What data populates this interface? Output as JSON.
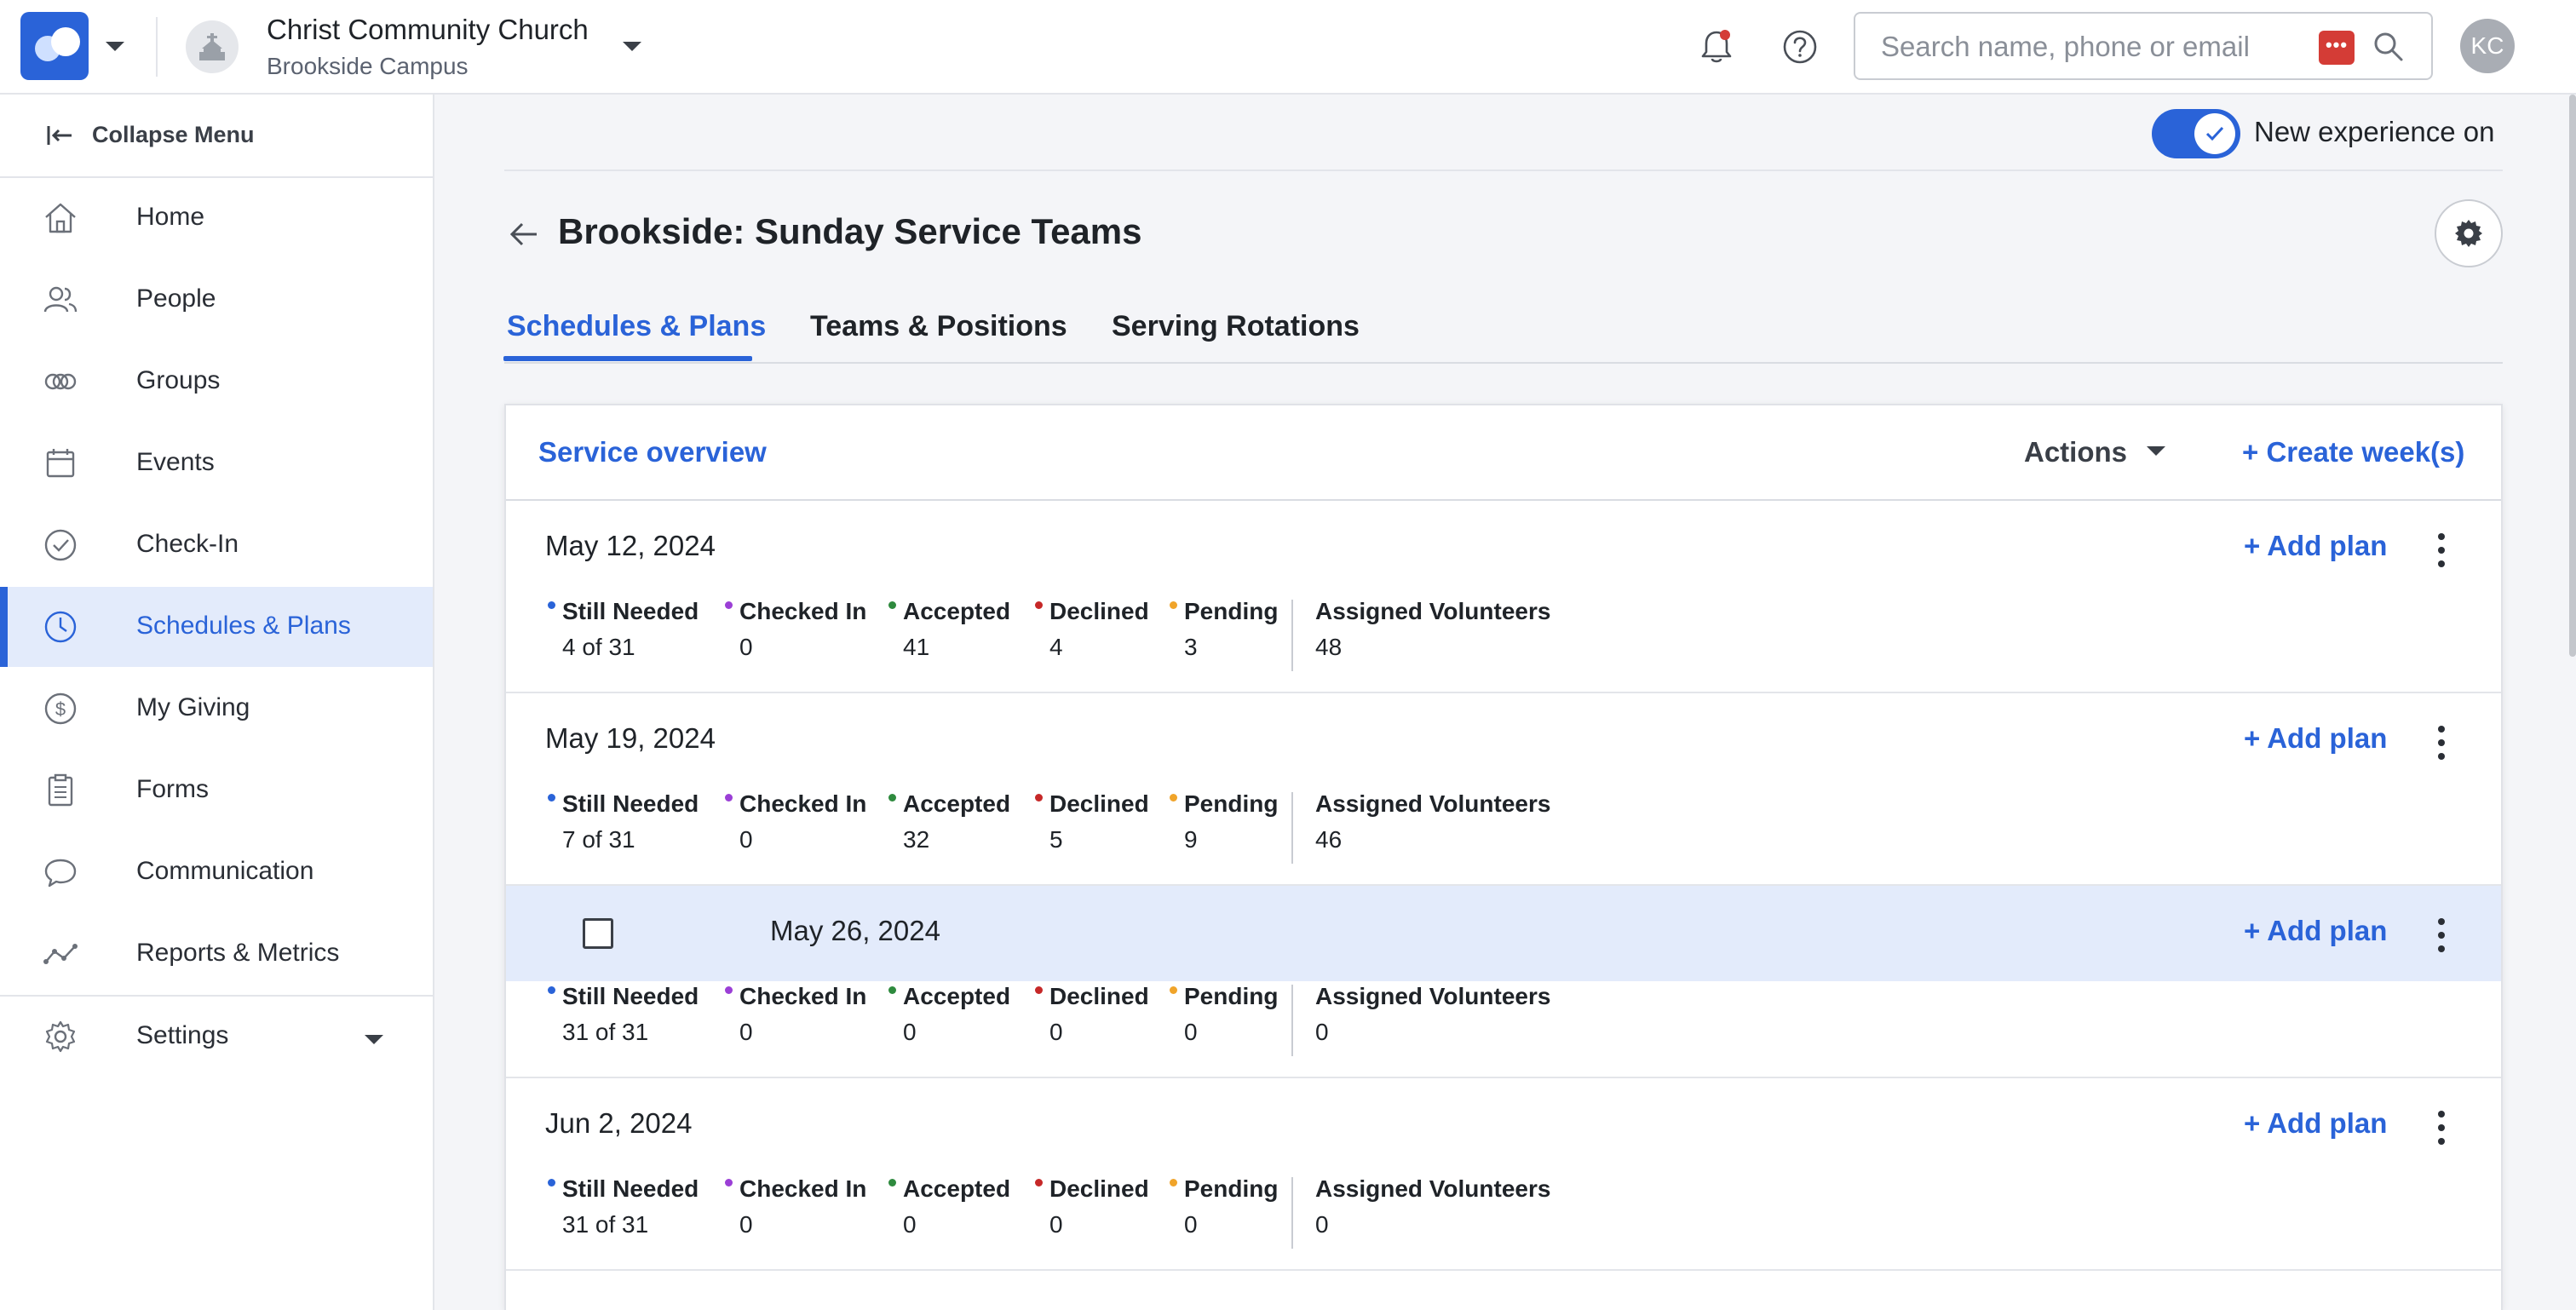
{
  "header": {
    "church_name": "Christ Community Church",
    "campus_name": "Brookside Campus",
    "search_placeholder": "Search name, phone or email",
    "user_initials": "KC",
    "accent_color": "#2a63d8"
  },
  "sidebar": {
    "collapse_label": "Collapse Menu",
    "items": [
      {
        "label": "Home",
        "icon": "home-icon"
      },
      {
        "label": "People",
        "icon": "people-icon"
      },
      {
        "label": "Groups",
        "icon": "groups-icon"
      },
      {
        "label": "Events",
        "icon": "calendar-icon"
      },
      {
        "label": "Check-In",
        "icon": "check-circle-icon"
      },
      {
        "label": "Schedules & Plans",
        "icon": "clock-icon",
        "active": true
      },
      {
        "label": "My Giving",
        "icon": "dollar-icon"
      },
      {
        "label": "Forms",
        "icon": "clipboard-icon"
      },
      {
        "label": "Communication",
        "icon": "chat-icon"
      },
      {
        "label": "Reports & Metrics",
        "icon": "metrics-icon"
      }
    ],
    "settings_label": "Settings"
  },
  "main": {
    "toggle_label": "New experience on",
    "toggle_on": true,
    "title": "Brookside: Sunday Service Teams",
    "tabs": [
      {
        "label": "Schedules & Plans",
        "active": true
      },
      {
        "label": "Teams & Positions"
      },
      {
        "label": "Serving Rotations"
      }
    ],
    "panel": {
      "overview_label": "Service overview",
      "actions_label": "Actions",
      "create_label": "+ Create week(s)"
    },
    "stat_labels": {
      "still_needed": "Still Needed",
      "checked_in": "Checked In",
      "accepted": "Accepted",
      "declined": "Declined",
      "pending": "Pending",
      "assigned": "Assigned Volunteers"
    },
    "status_colors": {
      "still_needed": "#2a63d8",
      "checked_in": "#9b3fd6",
      "accepted": "#2e8a3e",
      "declined": "#c62828",
      "pending": "#f0a42a"
    },
    "add_plan_label": "+ Add plan",
    "weeks": [
      {
        "date": "May 12, 2024",
        "still_needed": "4 of 31",
        "checked_in": "0",
        "accepted": "41",
        "declined": "4",
        "pending": "3",
        "assigned": "48"
      },
      {
        "date": "May 19, 2024",
        "still_needed": "7 of 31",
        "checked_in": "0",
        "accepted": "32",
        "declined": "5",
        "pending": "9",
        "assigned": "46"
      },
      {
        "date": "May 26, 2024",
        "still_needed": "31 of 31",
        "checked_in": "0",
        "accepted": "0",
        "declined": "0",
        "pending": "0",
        "assigned": "0",
        "selected": true
      },
      {
        "date": "Jun 2, 2024",
        "still_needed": "31 of 31",
        "checked_in": "0",
        "accepted": "0",
        "declined": "0",
        "pending": "0",
        "assigned": "0"
      }
    ]
  }
}
